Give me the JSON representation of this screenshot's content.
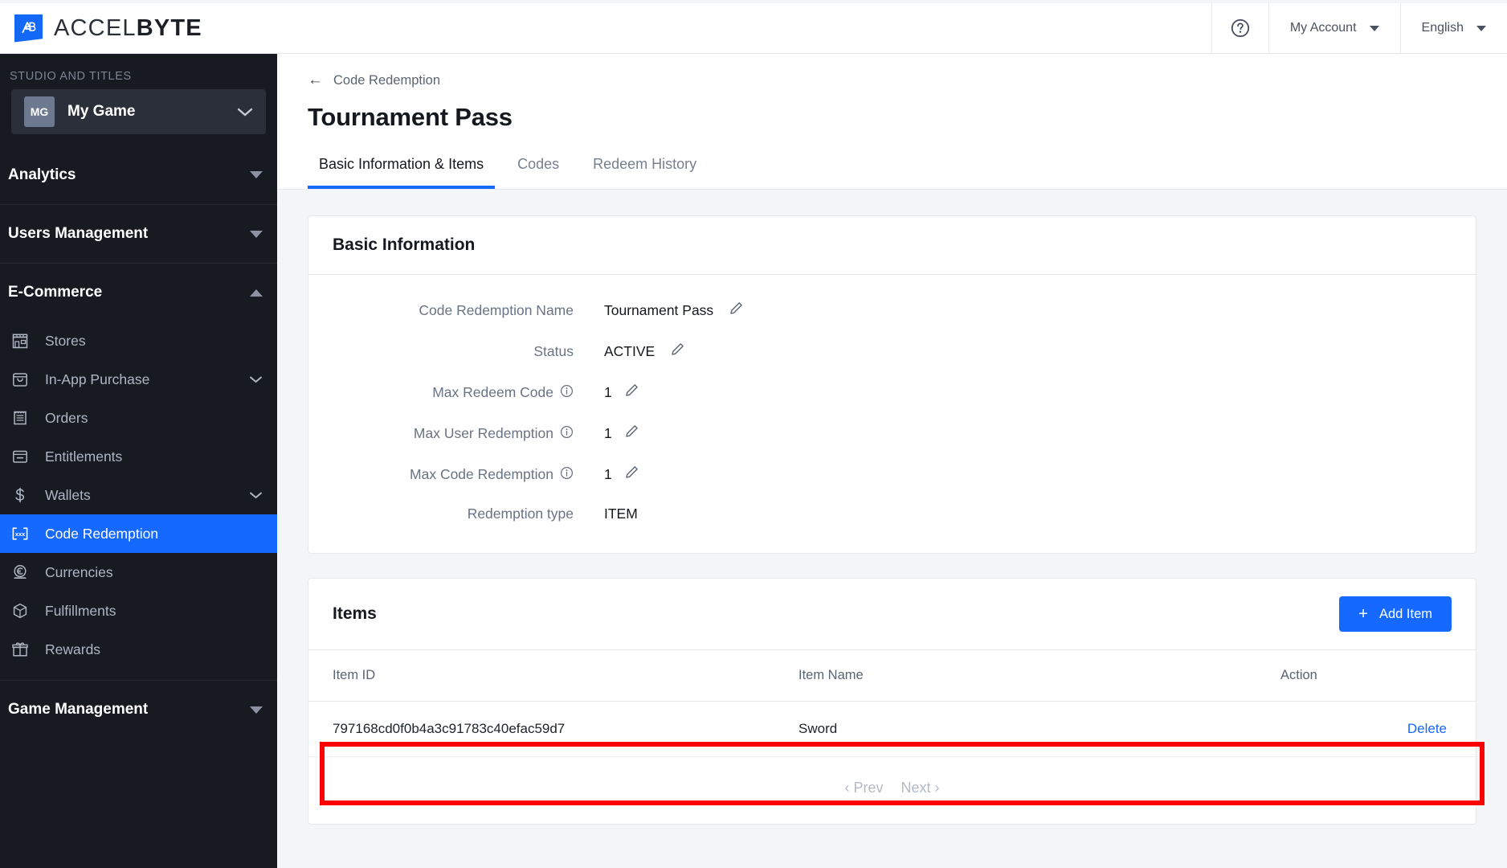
{
  "header": {
    "brand_primary": "ACCEL",
    "brand_secondary": "BYTE",
    "brand_mark": "AB",
    "help_icon": "question-circle-icon",
    "account_label": "My Account",
    "language_label": "English"
  },
  "sidebar": {
    "section_label": "STUDIO AND TITLES",
    "game": {
      "badge": "MG",
      "name": "My Game",
      "chevron": "⌄"
    },
    "groups": [
      {
        "label": "Analytics",
        "state": "collapsed"
      },
      {
        "label": "Users Management",
        "state": "collapsed"
      },
      {
        "label": "E-Commerce",
        "state": "expanded"
      },
      {
        "label": "Game Management",
        "state": "collapsed"
      }
    ],
    "ecommerce_items": [
      {
        "label": "Stores",
        "icon": "store-icon",
        "active": false,
        "chevron": ""
      },
      {
        "label": "In-App Purchase",
        "icon": "bag-icon",
        "active": false,
        "chevron": "⌄"
      },
      {
        "label": "Orders",
        "icon": "receipt-icon",
        "active": false,
        "chevron": ""
      },
      {
        "label": "Entitlements",
        "icon": "archive-icon",
        "active": false,
        "chevron": ""
      },
      {
        "label": "Wallets",
        "icon": "dollar-icon",
        "active": false,
        "chevron": "⌄"
      },
      {
        "label": "Code Redemption",
        "icon": "code-bracket-icon",
        "active": true,
        "chevron": ""
      },
      {
        "label": "Currencies",
        "icon": "euro-coin-icon",
        "active": false,
        "chevron": ""
      },
      {
        "label": "Fulfillments",
        "icon": "box-icon",
        "active": false,
        "chevron": ""
      },
      {
        "label": "Rewards",
        "icon": "gift-icon",
        "active": false,
        "chevron": ""
      }
    ]
  },
  "main": {
    "breadcrumb": "Code Redemption",
    "back_arrow": "←",
    "page_title": "Tournament Pass",
    "tabs": [
      {
        "label": "Basic Information & Items",
        "active": true
      },
      {
        "label": "Codes",
        "active": false
      },
      {
        "label": "Redeem History",
        "active": false
      }
    ],
    "basic_information": {
      "title": "Basic Information",
      "rows": [
        {
          "label": "Code Redemption Name",
          "value": "Tournament Pass",
          "info": false,
          "editable": true
        },
        {
          "label": "Status",
          "value": "ACTIVE",
          "info": false,
          "editable": true
        },
        {
          "label": "Max Redeem Code",
          "value": "1",
          "info": true,
          "editable": true
        },
        {
          "label": "Max User Redemption",
          "value": "1",
          "info": true,
          "editable": true
        },
        {
          "label": "Max Code Redemption",
          "value": "1",
          "info": true,
          "editable": true
        },
        {
          "label": "Redemption type",
          "value": "ITEM",
          "info": false,
          "editable": false
        }
      ]
    },
    "items": {
      "title": "Items",
      "add_button": "Add Item",
      "add_icon": "plus-icon",
      "columns": [
        "Item ID",
        "Item Name",
        "Action"
      ],
      "rows": [
        {
          "item_id": "797168cd0f0b4a3c91783c40efac59d7",
          "item_name": "Sword",
          "action": "Delete"
        }
      ],
      "pagination": {
        "prev": "‹ Prev",
        "next": "Next ›"
      }
    }
  },
  "annotation": {
    "highlight_color": "#fb0000"
  },
  "colors": {
    "accent": "#1569ff",
    "sidebar_bg": "#171a21",
    "page_bg": "#f4f5f7",
    "highlight": "#fb0000"
  }
}
